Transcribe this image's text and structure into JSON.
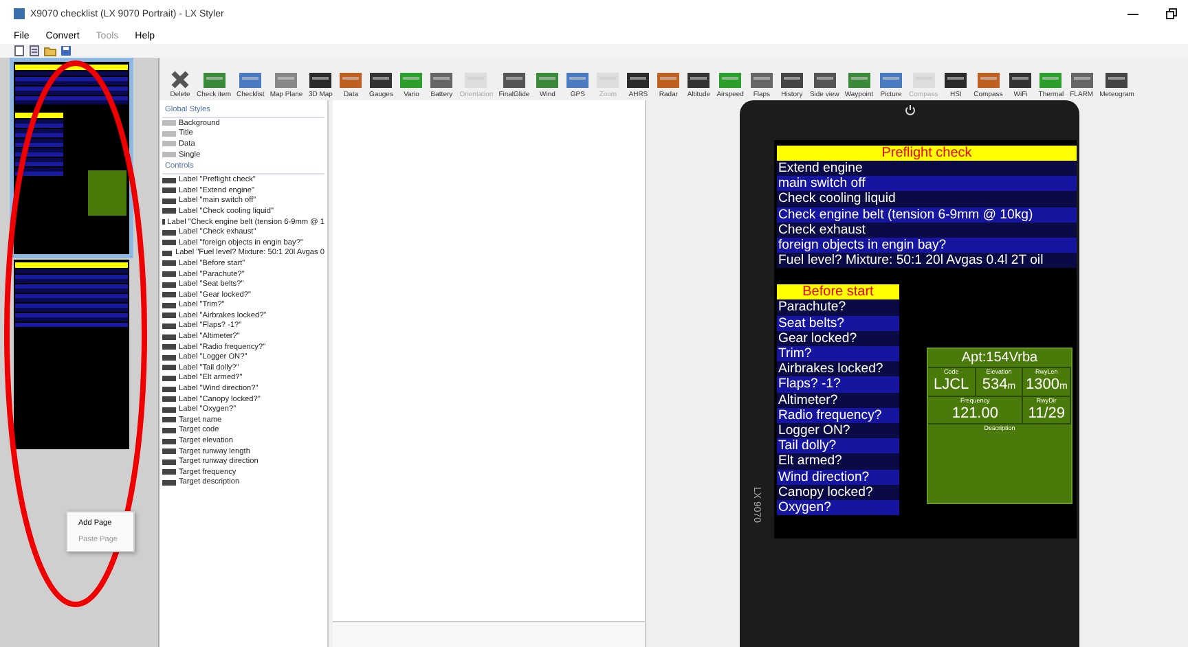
{
  "window": {
    "title": "X9070 checklist (LX 9070 Portrait) - LX Styler"
  },
  "menu": [
    {
      "label": "File",
      "disabled": false
    },
    {
      "label": "Convert",
      "disabled": false
    },
    {
      "label": "Tools",
      "disabled": true
    },
    {
      "label": "Help",
      "disabled": false
    }
  ],
  "context_menu": [
    {
      "label": "Add Page",
      "disabled": false
    },
    {
      "label": "Paste Page",
      "disabled": true
    }
  ],
  "toolbar": [
    {
      "label": "Delete",
      "disabled": false
    },
    {
      "label": "Check item",
      "disabled": false
    },
    {
      "label": "Checklist",
      "disabled": false
    },
    {
      "label": "Map Plane",
      "disabled": false
    },
    {
      "label": "3D Map",
      "disabled": false
    },
    {
      "label": "Data",
      "disabled": false
    },
    {
      "label": "Gauges",
      "disabled": false
    },
    {
      "label": "Vario",
      "disabled": false
    },
    {
      "label": "Battery",
      "disabled": false
    },
    {
      "label": "Orientation",
      "disabled": true
    },
    {
      "label": "FinalGlide",
      "disabled": false
    },
    {
      "label": "Wind",
      "disabled": false
    },
    {
      "label": "GPS",
      "disabled": false
    },
    {
      "label": "Zoom",
      "disabled": true
    },
    {
      "label": "AHRS",
      "disabled": false
    },
    {
      "label": "Radar",
      "disabled": false
    },
    {
      "label": "Altitude",
      "disabled": false
    },
    {
      "label": "Airspeed",
      "disabled": false
    },
    {
      "label": "Flaps",
      "disabled": false
    },
    {
      "label": "History",
      "disabled": false
    },
    {
      "label": "Side view",
      "disabled": false
    },
    {
      "label": "Waypoint",
      "disabled": false
    },
    {
      "label": "Picture",
      "disabled": false
    },
    {
      "label": "Compass",
      "disabled": true
    },
    {
      "label": "HSI",
      "disabled": false
    },
    {
      "label": "Compass",
      "disabled": false
    },
    {
      "label": "WiFi",
      "disabled": false
    },
    {
      "label": "Thermal",
      "disabled": false
    },
    {
      "label": "FLARM",
      "disabled": false
    },
    {
      "label": "Meteogram",
      "disabled": false
    }
  ],
  "tree": [
    {
      "title": "Global Styles",
      "items": [
        "Background",
        "Title",
        "Data",
        "Single"
      ]
    },
    {
      "title": "Controls",
      "items": [
        "Label \"Preflight check\"",
        "Label \"Extend engine\"",
        "Label \"main switch off\"",
        "Label \"Check cooling liquid\"",
        "Label \"Check engine belt (tension 6-9mm @ 1",
        "Label \"Check exhaust\"",
        "Label \"foreign objects in engin bay?\"",
        "Label \"Fuel level?  Mixture: 50:1  20l Avgas 0",
        "Label \"Before start\"",
        "Label \"Parachute?\"",
        "Label \"Seat belts?\"",
        "Label \"Gear locked?\"",
        "Label \"Trim?\"",
        "Label \"Airbrakes locked?\"",
        "Label \"Flaps?  -1?\"",
        "Label \"Altimeter?\"",
        "Label \"Radio frequency?\"",
        "Label \"Logger ON?\"",
        "Label \"Tail dolly?\"",
        "Label \"Elt armed?\"",
        "Label \"Wind direction?\"",
        "Label \"Canopy locked?\"",
        "Label \"Oxygen?\"",
        "Target name",
        "Target code",
        "Target elevation",
        "Target runway length",
        "Target runway direction",
        "Target frequency",
        "Target description"
      ]
    }
  ],
  "device": {
    "model": "LX 9070",
    "checklist": {
      "title": "Preflight check",
      "items": [
        "Extend engine",
        "main switch off",
        "Check cooling liquid",
        "Check engine belt (tension 6-9mm @ 10kg)",
        "Check exhaust",
        "foreign objects in engin bay?",
        "Fuel level?  Mixture: 50:1  20l Avgas 0.4l  2T oil"
      ]
    },
    "before_start": {
      "title": "Before start",
      "items": [
        "Parachute?",
        "Seat belts?",
        "Gear locked?",
        "Trim?",
        "Airbrakes locked?",
        "Flaps?  -1?",
        "Altimeter?",
        "Radio frequency?",
        "Logger ON?",
        "Tail dolly?",
        "Elt armed?",
        "Wind direction?",
        "Canopy locked?",
        "Oxygen?"
      ]
    },
    "airport": {
      "title": "Apt:154Vrba",
      "fields": [
        {
          "label": "Code",
          "value": "LJCL"
        },
        {
          "label": "Elevation",
          "value": "534",
          "unit": "m"
        },
        {
          "label": "RwyLen",
          "value": "1300",
          "unit": "m"
        }
      ],
      "fields2": [
        {
          "label": "Frequency",
          "value": "121.00"
        },
        {
          "label": "RwyDir",
          "value": "11/29"
        }
      ],
      "description_label": "Description"
    }
  }
}
